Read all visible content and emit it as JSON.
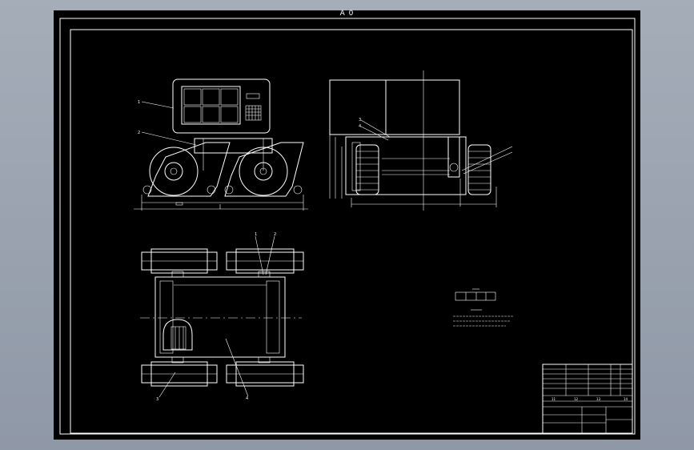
{
  "sheet": {
    "title": "A 0",
    "background": "#000000",
    "line_color": "#ffffff"
  },
  "views": {
    "front": {
      "balloons": [
        "1",
        "2"
      ]
    },
    "side": {
      "balloons": [
        "3",
        "4"
      ]
    },
    "top": {
      "balloons": [
        "1",
        "2",
        "3",
        "4"
      ]
    }
  },
  "title_block": {
    "col_numbers": [
      "11",
      "12",
      "13",
      "14"
    ]
  }
}
